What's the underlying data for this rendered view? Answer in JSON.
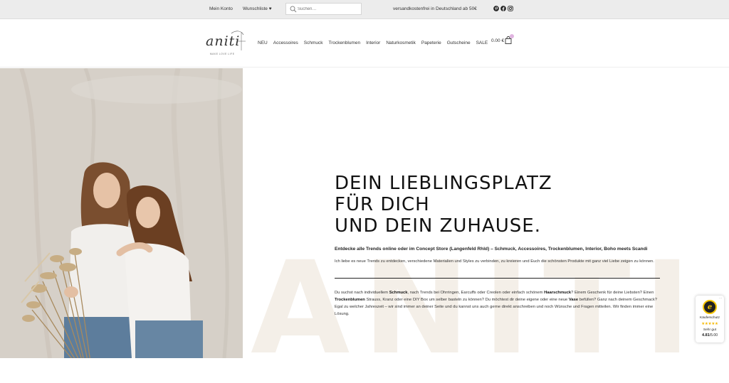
{
  "topbar": {
    "account": "Mein Konto",
    "wishlist": "Wunschliste ♥",
    "search_placeholder": "Suchen…",
    "shipping": "versandkostenfrei in Deutschland ab 50€",
    "social_icons": [
      "pinterest-icon",
      "facebook-icon",
      "instagram-icon"
    ]
  },
  "header": {
    "logo_word": "aniti",
    "logo_tagline": "MAKE LOVE LIFE",
    "nav": [
      "NEU",
      "Accessoires",
      "Schmuck",
      "Trockenblumen",
      "Interior",
      "Naturkosmetik",
      "Papeterie",
      "Gutscheine",
      "SALE"
    ],
    "cart_total": "0.00 €"
  },
  "hero": {
    "background_text": "ANITI",
    "headline": [
      "DEIN LIEBLINGSPLATZ",
      "FÜR DICH",
      "UND DEIN ZUHAUSE."
    ],
    "intro": "Entdecke alle Trends online oder im Concept Store (Langenfeld Rhld) – Schmuck, Accessoires, Trockenblumen, Interior, Boho meets Scandi",
    "sub": "Ich liebe es neue Trends zu entdecken, verschiedene Materialien und Styles zu verbinden, zu kreieren und Euch die schönsten Produkte mit ganz viel Liebe zeigen zu können.",
    "body": {
      "p1": "Du suchst nach individuellem ",
      "b1": "Schmuck",
      "p2": ", nach Trends bei Ohrringen, Earcuffs oder Creolen oder einfach schönem ",
      "b2": "Haarschmuck",
      "p3": "? Einem Geschenk für deine Liebsten? Einen ",
      "b3": "Trockenblumen",
      "p4": " Strauss, Kranz oder eine DIY Box um selber basteln zu können? Du möchtest dir deine eigene oder eine neue ",
      "b4": "Vase",
      "p5": " befüllen? Ganz nach deinem Geschmack? Egal zu welcher Jahreszeit – wir sind immer an deiner Seite und du kannst uns auch gerne direkt anschreiben und noch Wünsche und Fragen mitteilen. Wir finden immer eine Lösung."
    }
  },
  "badge": {
    "label": "Käuferschutz",
    "stars": "★★★★★",
    "rating_text": "Sehr gut",
    "score": "4.81",
    "score_max": "/5.00",
    "more": "···"
  },
  "colors": {
    "topbar_bg": "#ececec",
    "accent_cart_dot": "#e0b3e0",
    "badge_gold": "#f5c400",
    "watermark": "#f4efe8"
  }
}
